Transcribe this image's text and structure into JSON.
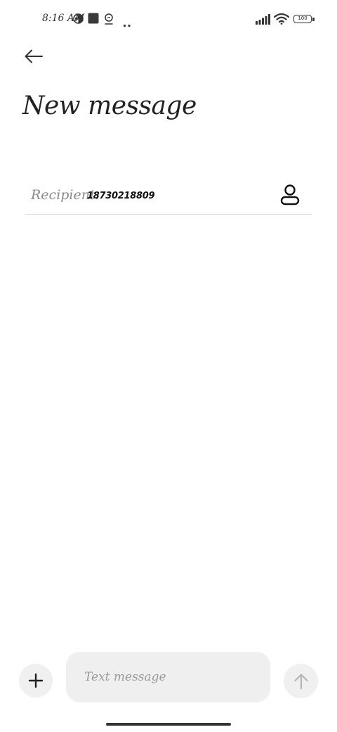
{
  "status_bar": {
    "time": "8:16 AM",
    "battery": "100",
    "icons": [
      "theme-icon",
      "square-app-icon",
      "location-icon",
      "more-dots-icon",
      "signal-icon",
      "wifi-icon",
      "battery-icon"
    ]
  },
  "header": {
    "back_icon": "arrow-left-icon",
    "title": "New message"
  },
  "recipient": {
    "label": "Recipient:",
    "value": "18730218809",
    "contact_icon": "person-icon"
  },
  "composer": {
    "add_icon": "plus-icon",
    "placeholder": "Text message",
    "value": "",
    "send_icon": "arrow-up-icon"
  },
  "colors": {
    "background": "#ffffff",
    "input_bg": "#efefef",
    "button_bg": "#f0f0f0",
    "text": "#222222",
    "muted": "#8a8a8a",
    "divider": "#dcdcdc",
    "send_disabled": "#b5b5b5"
  }
}
